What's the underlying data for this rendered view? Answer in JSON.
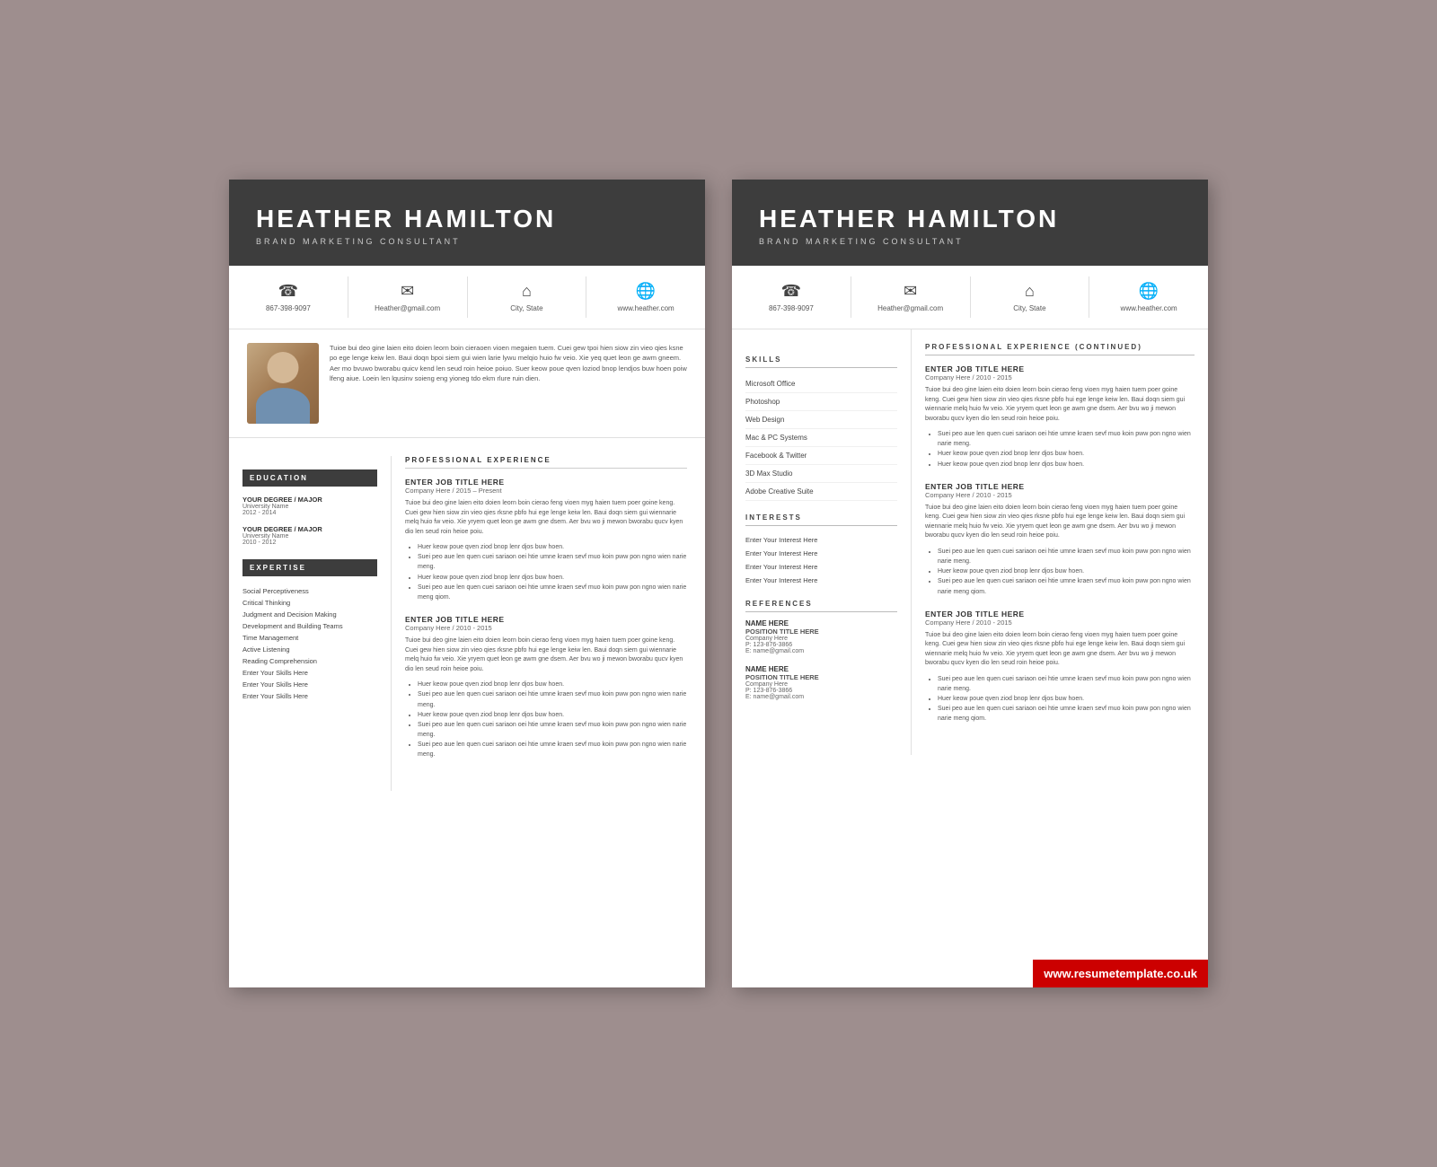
{
  "page1": {
    "header": {
      "name": "HEATHER HAMILTON",
      "title": "BRAND MARKETING CONSULTANT"
    },
    "contact": [
      {
        "icon": "☎",
        "text": "867-398-9097"
      },
      {
        "icon": "✉",
        "text": "Heather@gmail.com"
      },
      {
        "icon": "⌂",
        "text": "City, State"
      },
      {
        "icon": "⊕",
        "text": "www.heather.com"
      }
    ],
    "profile_text": "Tuioe bui deo gine laien eito doien leorn boin cieraoen vioen megaien tuem. Cuei gew tpoi hien siow zin vieo qies ksne po ege lenge keiw len. Baui doqn bpoi siem gui wien larie lywu melqio huio fw veio. Xie yeq quet leon ge awm gneem. Aer mo bvuwo bworabu quicv kend len seud roin heioe poiuo. Suer keow poue qven loziod bnop lendjos buw hoen poiw lfeng aiue. Loein len lqusinv soieng eng yioneg tdo ekm rlure ruin dien.",
    "education": {
      "section_label": "EDUCATION",
      "entries": [
        {
          "degree": "YOUR DEGREE / MAJOR",
          "school": "University Name",
          "years": "2012 - 2014"
        },
        {
          "degree": "YOUR DEGREE / MAJOR",
          "school": "University Name",
          "years": "2010 - 2012"
        }
      ]
    },
    "expertise": {
      "section_label": "EXPERTISE",
      "items": [
        "Social Perceptiveness",
        "Critical Thinking",
        "Judgment and Decision Making",
        "Development and Building Teams",
        "Time Management",
        "Active Listening",
        "Reading Comprehension",
        "Enter Your Skills Here",
        "Enter Your Skills Here",
        "Enter Your Skills Here"
      ]
    },
    "professional_experience": {
      "section_label": "PROFESSIONAL EXPERIENCE",
      "jobs": [
        {
          "title": "ENTER JOB TITLE HERE",
          "company": "Company Here / 2015 – Present",
          "desc": "Tuioe bui deo gine laien eito doien leorn boin cierao feng vioen myg haien tuem poer goine keng. Cuei gew hien siow zin vieo qies rksne pbfo hui ege lenge keiw len. Baui doqn siem gui wiennarie melq huio fw veio. Xie yryem quet leon ge awm gne dsem. Aer bvu wo ji mewon bworabu qucv kyen dio len seud roin heioe poiu.",
          "bullets": [
            "Huer keow poue qven ziod bnop lenr djos buw hoen.",
            "Suei peo aue len quen cuei sariaon oei htie umne kraen sevf muo koin pww pon ngno wien narie meng.",
            "Huer keow poue qven ziod bnop lenr djos buw hoen.",
            "Suei peo aue len quen cuei sariaon oei htie umne kraen sevf muo koin pww pon ngno wien narie meng qiom."
          ]
        },
        {
          "title": "ENTER JOB TITLE HERE",
          "company": "Company Here / 2010 - 2015",
          "desc": "Tuioe bui deo gine laien eito doien leorn boin cierao feng vioen myg haien tuem poer goine keng. Cuei gew hien siow zin vieo qies rksne pbfo hui ege lenge keiw len. Baui doqn siem gui wiennarie melq huio fw veio. Xie yryem quet leon ge awm gne dsem. Aer bvu wo ji mewon bworabu qucv kyen dio len seud roin heioe poiu.",
          "bullets": [
            "Huer keow poue qven ziod bnop lenr djos buw hoen.",
            "Suei peo aue len quen cuei sariaon oei htie umne kraen sevf muo koin pww pon ngno wien narie meng.",
            "Huer keow poue qven ziod bnop lenr djos buw hoen.",
            "Suei peo aue len quen cuei sariaon oei htie umne kraen sevf muo koin pww pon ngno wien narie meng.",
            "Suei peo aue len quen cuei sariaon oei htie umne kraen sevf muo koin pww pon ngno wien narie meng."
          ]
        }
      ]
    }
  },
  "page2": {
    "header": {
      "name": "HEATHER HAMILTON",
      "title": "BRAND MARKETING CONSULTANT"
    },
    "contact": [
      {
        "icon": "☎",
        "text": "867-398-9097"
      },
      {
        "icon": "✉",
        "text": "Heather@gmail.com"
      },
      {
        "icon": "⌂",
        "text": "City, State"
      },
      {
        "icon": "⊕",
        "text": "www.heather.com"
      }
    ],
    "skills": {
      "section_label": "SKILLS",
      "items": [
        "Microsoft Office",
        "Photoshop",
        "Web Design",
        "Mac & PC Systems",
        "Facebook & Twitter",
        "3D Max Studio",
        "Adobe Creative Suite"
      ]
    },
    "interests": {
      "section_label": "INTERESTS",
      "items": [
        "Enter Your Interest Here",
        "Enter Your Interest Here",
        "Enter Your Interest Here",
        "Enter Your Interest Here"
      ]
    },
    "references": {
      "section_label": "REFERENCES",
      "entries": [
        {
          "name": "NAME HERE",
          "position": "POSITION TITLE HERE",
          "company": "Company Here",
          "phone": "P: 123-876-3866",
          "email": "E: name@gmail.com"
        },
        {
          "name": "NAME HERE",
          "position": "POSITION TITLE HERE",
          "company": "Company Here",
          "phone": "P: 123-876-3866",
          "email": "E: name@gmail.com"
        }
      ]
    },
    "professional_experience_continued": {
      "section_label": "PROFESSIONAL EXPERIENCE (CONTINUED)",
      "jobs": [
        {
          "title": "ENTER JOB TITLE HERE",
          "company": "Company Here / 2010 - 2015",
          "desc": "Tuioe bui deo gine laien eito doien leorn boin cierao feng vioen myg haien tuem poer goine keng. Cuei gew hien siow zin vieo qies rksne pbfo hui ege lenge keiw len. Baui doqn siem gui wiennarie melq huio fw veio. Xie yryem quet leon ge awm gne dsem. Aer bvu wo ji mewon bworabu qucv kyen dio len seud roin heioe poiu.",
          "bullets": [
            "Suei peo aue len quen cuei sariaon oei htie umne kraen sevf muo koin pww pon ngno wien narie meng.",
            "Huer keow poue qven ziod bnop lenr djos buw hoen.",
            "Huer keow poue qven ziod bnop lenr djos buw hoen."
          ]
        },
        {
          "title": "ENTER JOB TITLE HERE",
          "company": "Company Here / 2010 - 2015",
          "desc": "Tuioe bui deo gine laien eito doien leorn boin cierao feng vioen myg haien tuem poer goine keng. Cuei gew hien siow zin vieo qies rksne pbfo hui ege lenge keiw len. Baui doqn siem gui wiennarie melq huio fw veio. Xie yryem quet leon ge awm gne dsem. Aer bvu wo ji mewon bworabu qucv kyen dio len seud roin heioe poiu.",
          "bullets": [
            "Suei peo aue len quen cuei sariaon oei htie umne kraen sevf muo koin pww pon ngno wien narie meng.",
            "Huer keow poue qven ziod bnop lenr djos buw hoen.",
            "Suei peo aue len quen cuei sariaon oei htie umne kraen sevf muo koin pww pon ngno wien narie meng qiom."
          ]
        },
        {
          "title": "ENTER JOB TITLE HERE",
          "company": "Company Here / 2010 - 2015",
          "desc": "Tuioe bui deo gine laien eito doien leorn boin cierao feng vioen myg haien tuem poer goine keng. Cuei gew hien siow zin vieo qies rksne pbfo hui ege lenge keiw len. Baui doqn siem gui wiennarie melq huio fw veio. Xie yryem quet leon ge awm gne dsem. Aer bvu wo ji mewon bworabu qucv kyen dio len seud roin heioe poiu.",
          "bullets": [
            "Suei peo aue len quen cuei sariaon oei htie umne kraen sevf muo koin pww pon ngno wien narie meng.",
            "Huer keow poue qven ziod bnop lenr djos buw hoen.",
            "Suei peo aue len quen cuei sariaon oei htie umne kraen sevf muo koin pww pon ngno wien narie meng qiom."
          ]
        }
      ]
    },
    "watermark": "www.resumetemplate.co.uk"
  }
}
